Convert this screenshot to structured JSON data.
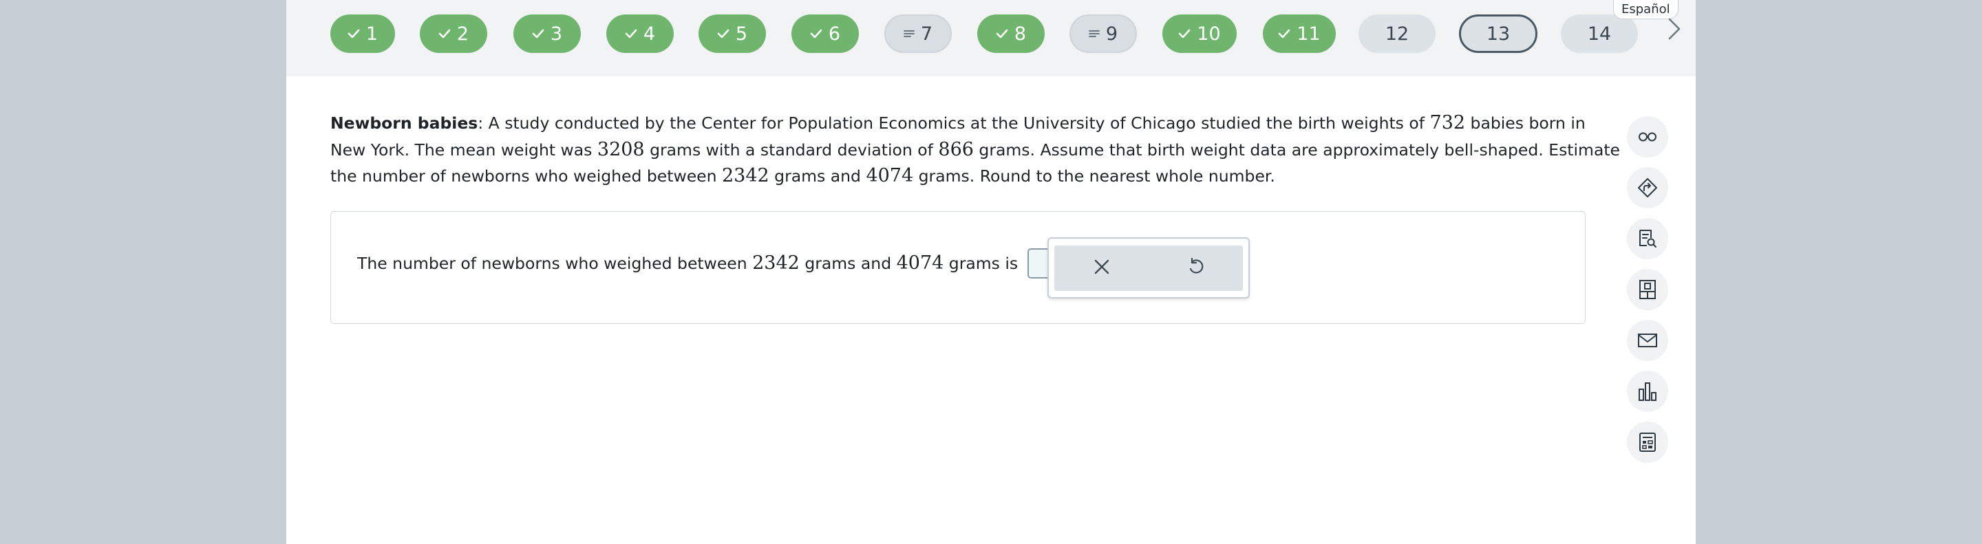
{
  "language_toggle": "Español",
  "question_nav": [
    {
      "label": "1",
      "status": "done"
    },
    {
      "label": "2",
      "status": "done"
    },
    {
      "label": "3",
      "status": "done"
    },
    {
      "label": "4",
      "status": "done"
    },
    {
      "label": "5",
      "status": "done"
    },
    {
      "label": "6",
      "status": "done"
    },
    {
      "label": "7",
      "status": "partial"
    },
    {
      "label": "8",
      "status": "done"
    },
    {
      "label": "9",
      "status": "partial"
    },
    {
      "label": "10",
      "status": "done"
    },
    {
      "label": "11",
      "status": "done"
    },
    {
      "label": "12",
      "status": "todo"
    },
    {
      "label": "13",
      "status": "current"
    },
    {
      "label": "14",
      "status": "todo"
    }
  ],
  "problem": {
    "title": "Newborn babies",
    "t1": ": A study conducted by the Center for Population Economics at the University of Chicago studied the birth weights of ",
    "n1": "732",
    "t2": " babies born in New York. The mean weight was ",
    "n2": "3208",
    "t3": " grams with a standard deviation of ",
    "n3": "866",
    "t4": " grams. Assume that birth weight data are approximately bell-shaped. Estimate the number of newborns who weighed between ",
    "n4": "2342",
    "t5": " grams and ",
    "n5": "4074",
    "t6": " grams. Round to the nearest whole number."
  },
  "answer": {
    "a1": "The number of newborns who weighed between ",
    "n1": "2342",
    "a2": " grams and ",
    "n2": "4074",
    "a3": " grams is",
    "end": ".",
    "value": ""
  },
  "keypad": {
    "clear_icon": "close-icon",
    "undo_icon": "undo-icon"
  },
  "tools": [
    "glasses-icon",
    "route-icon",
    "document-search-icon",
    "textbook-icon",
    "mail-icon",
    "bar-chart-icon",
    "calculator-icon"
  ],
  "colors": {
    "done": "#6fb56e",
    "pending": "#dde2e6",
    "current_border": "#4a5964",
    "background": "#c7ced4"
  }
}
